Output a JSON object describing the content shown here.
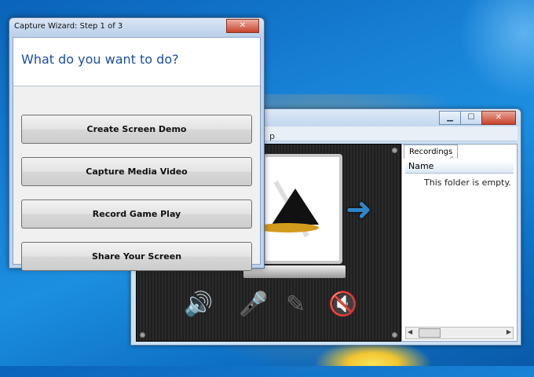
{
  "wizard": {
    "title": "Capture Wizard: Step 1 of 3",
    "close_glyph": "✕",
    "question": "What do you want to do?",
    "options": [
      {
        "label": "Create Screen Demo"
      },
      {
        "label": "Capture Media Video"
      },
      {
        "label": "Record Game Play"
      },
      {
        "label": "Share Your Screen"
      }
    ]
  },
  "recorder": {
    "title_fragment": "p",
    "window_buttons": {
      "minimize": "▁",
      "maximize": "☐",
      "close": "✕"
    },
    "recordings_tab": "Recordings",
    "column_name": "Name",
    "sort_glyph": "^",
    "empty_text": "This folder is empty.",
    "scroll_left": "◀",
    "scroll_right": "▶",
    "icons": [
      "speaker-icon",
      "microphone-icon",
      "pen-icon",
      "muted-speaker-icon"
    ]
  }
}
